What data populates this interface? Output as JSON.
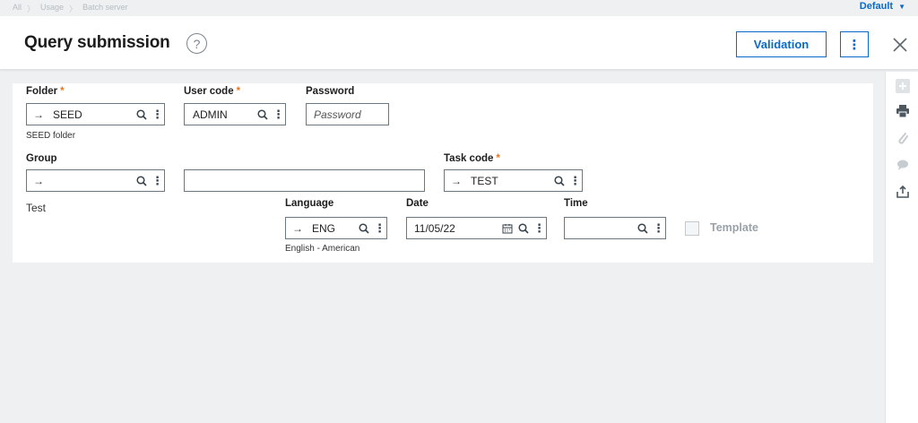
{
  "breadcrumb": [
    "All",
    "Usage",
    "Batch server"
  ],
  "profile": {
    "label": "Default"
  },
  "header": {
    "title": "Query submission",
    "help": "?",
    "validation_label": "Validation",
    "more": "⋮",
    "close": "✕"
  },
  "form": {
    "folder": {
      "label": "Folder",
      "value": "SEED",
      "description": "SEED folder"
    },
    "user_code": {
      "label": "User code",
      "value": "ADMIN"
    },
    "password": {
      "label": "Password",
      "placeholder": "Password"
    },
    "group": {
      "label": "Group",
      "value": ""
    },
    "group_description": "",
    "task_code": {
      "label": "Task code",
      "value": "TEST"
    },
    "task_description": "Test",
    "language": {
      "label": "Language",
      "value": "ENG",
      "description": "English - American"
    },
    "date": {
      "label": "Date",
      "value": "11/05/22"
    },
    "time": {
      "label": "Time",
      "value": ""
    },
    "template": {
      "label": "Template",
      "checked": false
    }
  },
  "rail_icons": [
    "plus-icon",
    "print-icon",
    "attachment-icon",
    "comment-icon",
    "export-icon"
  ],
  "colors": {
    "accent": "#0a6ac9",
    "required": "#e87722"
  }
}
